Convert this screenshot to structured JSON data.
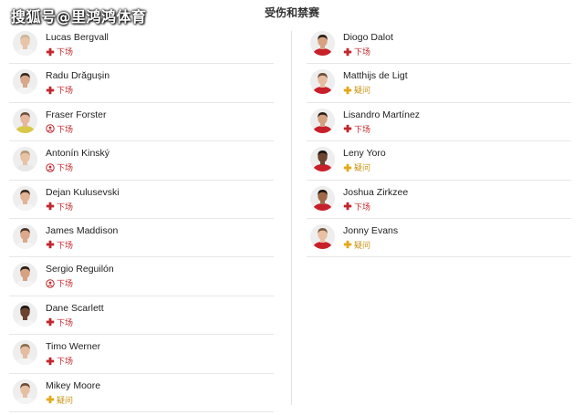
{
  "watermark": "搜狐号@里鸿鸿体育",
  "title": "受伤和禁赛",
  "colors": {
    "out": "#c1272d",
    "doubt": "#e3a81a"
  },
  "left_players": [
    {
      "name": "Lucas Bergvall",
      "status": "下场",
      "icon": "injury-cross-icon",
      "kind": "out",
      "skin": "#e8c4a8",
      "hair": "#c9b79a",
      "shirt": "#f4f4f4"
    },
    {
      "name": "Radu Drăgușin",
      "status": "下场",
      "icon": "injury-cross-icon",
      "kind": "out",
      "skin": "#d9a88b",
      "hair": "#3a2a22",
      "shirt": "#f4f4f4"
    },
    {
      "name": "Fraser Forster",
      "status": "下场",
      "icon": "suspension-icon",
      "kind": "out",
      "skin": "#e6b79c",
      "hair": "#6b4e3b",
      "shirt": "#d8c84a"
    },
    {
      "name": "Antonín Kinský",
      "status": "下场",
      "icon": "suspension-icon",
      "kind": "out",
      "skin": "#e9c2a6",
      "hair": "#b59a7a",
      "shirt": "#e8e8e8"
    },
    {
      "name": "Dejan Kulusevski",
      "status": "下场",
      "icon": "injury-cross-icon",
      "kind": "out",
      "skin": "#e2b394",
      "hair": "#3d2b20",
      "shirt": "#f4f4f4"
    },
    {
      "name": "James Maddison",
      "status": "下场",
      "icon": "injury-cross-icon",
      "kind": "out",
      "skin": "#dba98a",
      "hair": "#4a3226",
      "shirt": "#f4f4f4"
    },
    {
      "name": "Sergio Reguilón",
      "status": "下场",
      "icon": "suspension-icon",
      "kind": "out",
      "skin": "#d6a282",
      "hair": "#2a1e18",
      "shirt": "#f4f4f4"
    },
    {
      "name": "Dane Scarlett",
      "status": "下场",
      "icon": "injury-cross-icon",
      "kind": "out",
      "skin": "#6b4430",
      "hair": "#1e1512",
      "shirt": "#f4f4f4"
    },
    {
      "name": "Timo Werner",
      "status": "下场",
      "icon": "injury-cross-icon",
      "kind": "out",
      "skin": "#e6bca0",
      "hair": "#8a6a4c",
      "shirt": "#f4f4f4"
    },
    {
      "name": "Mikey Moore",
      "status": "疑问",
      "icon": "doubt-cross-icon",
      "kind": "doubt",
      "skin": "#e6bfa3",
      "hair": "#6e4d36",
      "shirt": "#f4f4f4"
    }
  ],
  "right_players": [
    {
      "name": "Diogo Dalot",
      "status": "下场",
      "icon": "injury-cross-icon",
      "kind": "out",
      "skin": "#d8a282",
      "hair": "#2b1d16",
      "shirt": "#c8202a"
    },
    {
      "name": "Matthijs de Ligt",
      "status": "疑问",
      "icon": "doubt-cross-icon",
      "kind": "doubt",
      "skin": "#e6bca0",
      "hair": "#6b4c36",
      "shirt": "#c8202a"
    },
    {
      "name": "Lisandro Martínez",
      "status": "下场",
      "icon": "injury-cross-icon",
      "kind": "out",
      "skin": "#d4a080",
      "hair": "#2b1d16",
      "shirt": "#c8202a"
    },
    {
      "name": "Leny Yoro",
      "status": "疑问",
      "icon": "doubt-cross-icon",
      "kind": "doubt",
      "skin": "#6e4530",
      "hair": "#1c1410",
      "shirt": "#c8202a"
    },
    {
      "name": "Joshua Zirkzee",
      "status": "下场",
      "icon": "injury-cross-icon",
      "kind": "out",
      "skin": "#a06a4a",
      "hair": "#1e1410",
      "shirt": "#c8202a"
    },
    {
      "name": "Jonny Evans",
      "status": "疑问",
      "icon": "doubt-cross-icon",
      "kind": "doubt",
      "skin": "#e8c0a4",
      "hair": "#7a5a40",
      "shirt": "#c8202a"
    }
  ]
}
